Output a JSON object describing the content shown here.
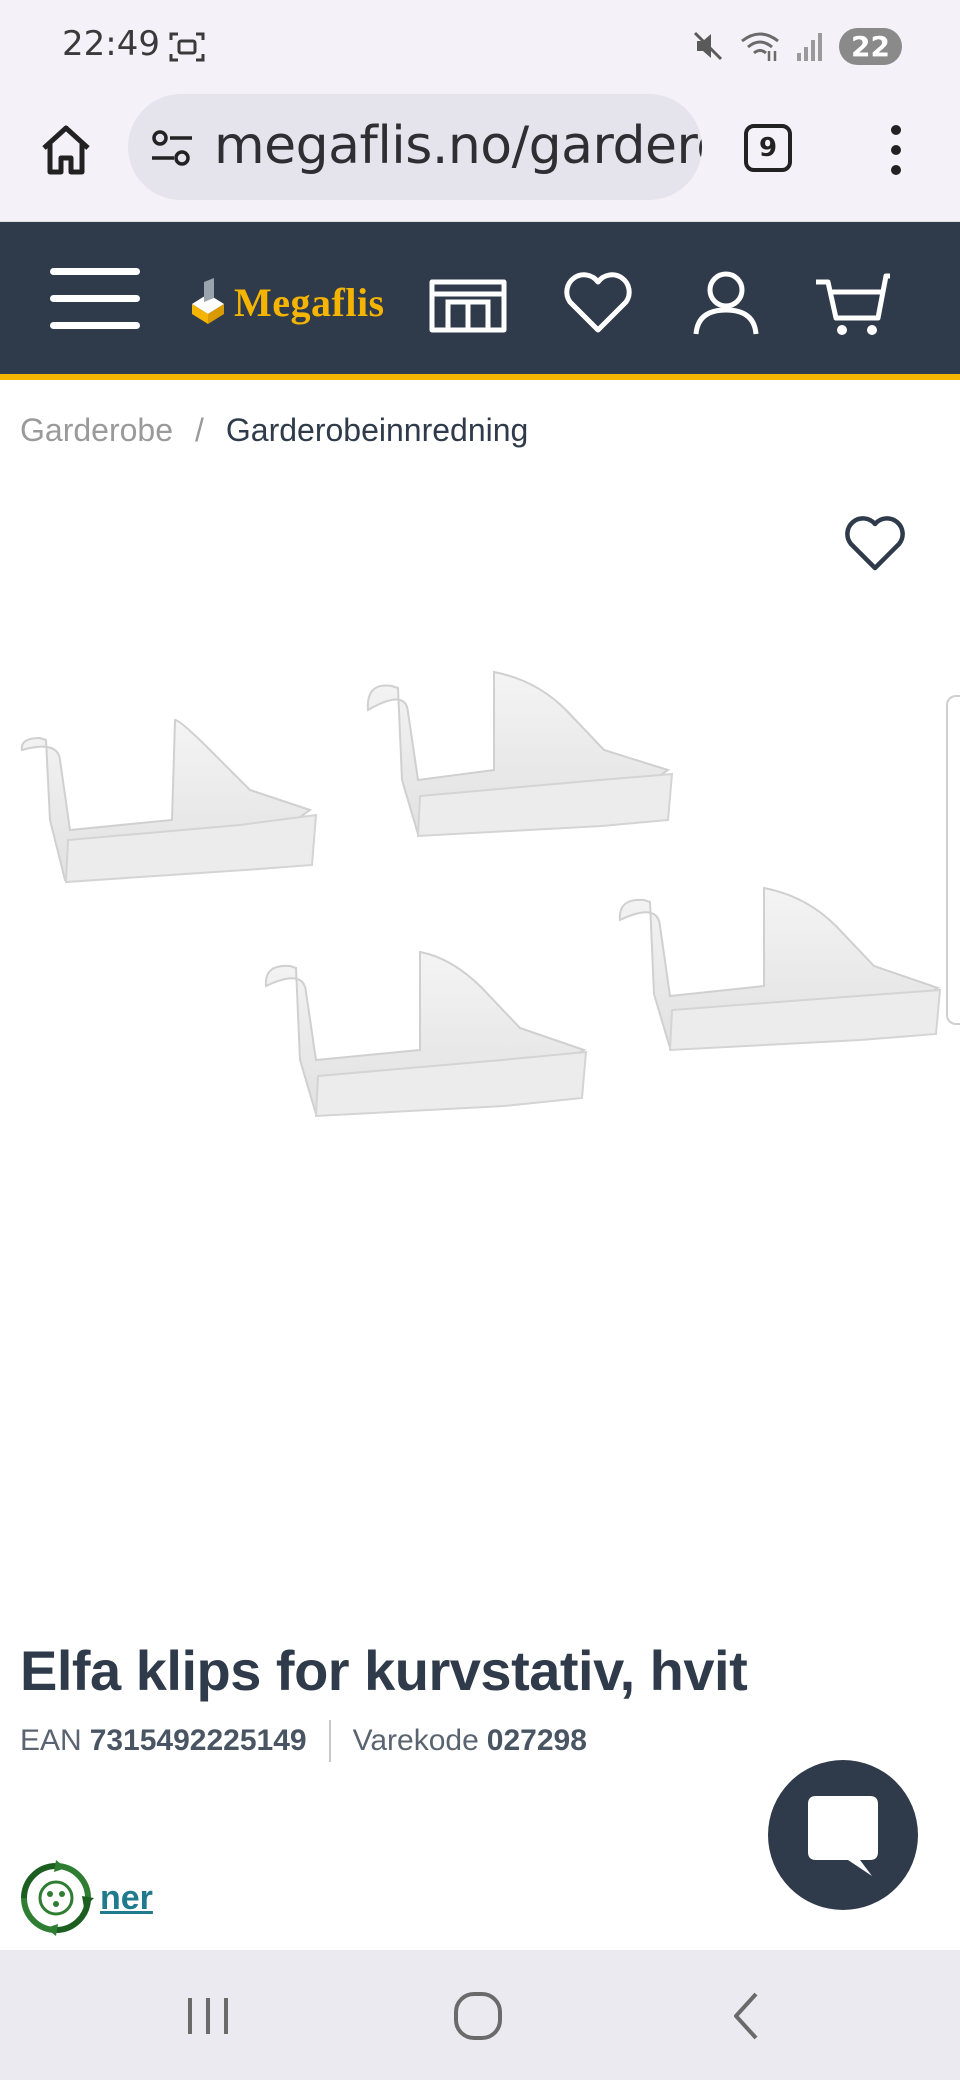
{
  "status_bar": {
    "time": "22:49",
    "battery": "22",
    "icons": [
      "screenshot-icon",
      "mute-icon",
      "wifi-icon",
      "signal-icon"
    ]
  },
  "browser": {
    "url": "megaflis.no/garderobe/garderobeinnredning",
    "tab_count": "9",
    "icons": [
      "home-icon",
      "site-settings-icon",
      "more-vert-icon"
    ]
  },
  "header": {
    "logo_text": "Megaflis",
    "colors": {
      "background": "#2f3b4a",
      "accent": "#f5b400"
    },
    "icons": [
      "hamburger-menu-icon",
      "showroom-icon",
      "heart-icon",
      "user-icon",
      "cart-icon"
    ]
  },
  "breadcrumb": {
    "items": [
      "Garderobe",
      "Garderobeinnredning"
    ],
    "separator": "/"
  },
  "product": {
    "title": "Elfa klips for kurvstativ, hvit",
    "ean_label": "EAN",
    "ean_value": "7315492225149",
    "sku_label": "Varekode",
    "sku_value": "027298",
    "eco_link_text": "ner"
  },
  "nav": {
    "icons": [
      "recent-apps-icon",
      "home-circle-icon",
      "back-icon"
    ]
  }
}
